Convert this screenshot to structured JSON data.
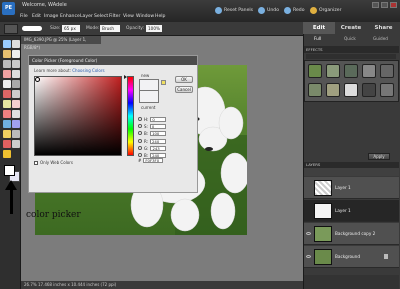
{
  "app": {
    "welcome_label": "Welcome, WAdele",
    "logo_text": "PE"
  },
  "menu": [
    "File",
    "Edit",
    "Image",
    "Enhance",
    "Layer",
    "Select",
    "Filter",
    "View",
    "Window",
    "Help"
  ],
  "top_buttons": {
    "reset_panels": "Reset Panels",
    "undo": "Undo",
    "redo": "Redo",
    "organizer": "Organizer"
  },
  "options": {
    "size_label": "Size:",
    "size_value": "65 px",
    "mode_label": "Mode:",
    "mode_value": "Brush",
    "opacity_label": "Opacity:",
    "opacity_value": "100%"
  },
  "document": {
    "tab": "IMG_6390.JPG @ 25% (Layer 1, RGB/8*)",
    "status": "26.7%  17.468 inches x 10.444 inches (72 ppi)"
  },
  "color_picker": {
    "title": "Color Picker (Foreground Color)",
    "learn_prefix": "Learn more about:",
    "learn_link": "Choosing Colors",
    "new_label": "new",
    "current_label": "current",
    "ok_label": "OK",
    "cancel_label": "Cancel",
    "only_web_label": "Only Web Colors",
    "fields": [
      {
        "label": "H:",
        "value": "0"
      },
      {
        "label": "S:",
        "value": "0"
      },
      {
        "label": "B:",
        "value": "100"
      },
      {
        "label": "R:",
        "value": "240"
      },
      {
        "label": "G:",
        "value": "243"
      },
      {
        "label": "B:",
        "value": "240"
      }
    ],
    "hex_label": "#",
    "hex_value": "F0F3F0",
    "new_color": "#f2f2f4",
    "current_color": "#f2f2f4"
  },
  "annotation": {
    "text": "color picker"
  },
  "right_panel": {
    "tabs": {
      "edit": "Edit",
      "create": "Create",
      "share": "Share"
    },
    "subtabs": {
      "full": "Full",
      "quick": "Quick",
      "guided": "Guided"
    },
    "effects_header": "EFFECTS",
    "apply_label": "Apply",
    "layers_header": "LAYERS",
    "layers": [
      {
        "name": "Layer 1"
      },
      {
        "name": "Layer 1"
      },
      {
        "name": "Background copy 2"
      },
      {
        "name": "Background"
      }
    ]
  },
  "colors": {
    "foreground": "#ffffff",
    "background": "#e6e6f4"
  }
}
